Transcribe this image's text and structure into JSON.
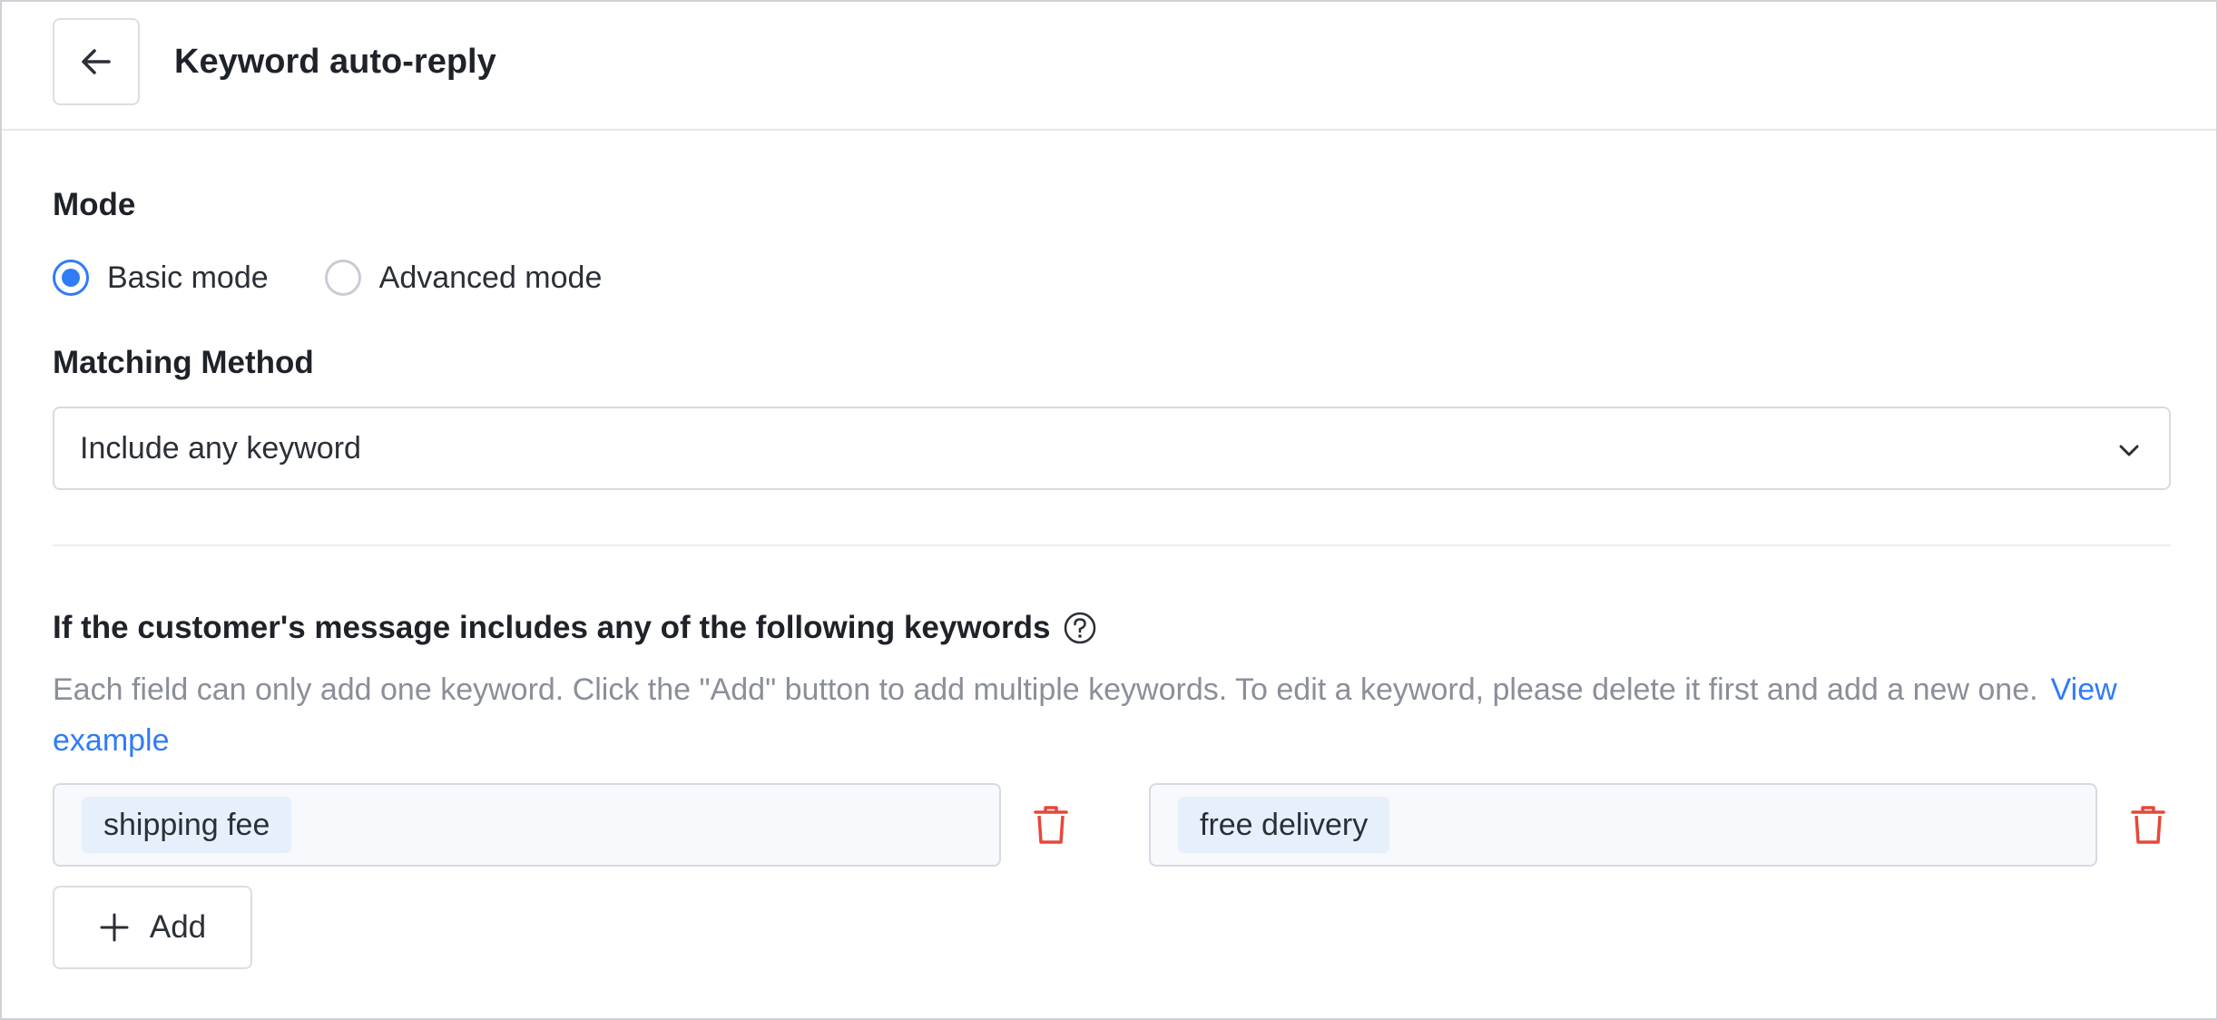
{
  "header": {
    "title": "Keyword auto-reply"
  },
  "mode": {
    "label": "Mode",
    "options": [
      {
        "label": "Basic mode",
        "checked": true
      },
      {
        "label": "Advanced mode",
        "checked": false
      }
    ]
  },
  "matching": {
    "label": "Matching Method",
    "selected": "Include any keyword"
  },
  "keywords": {
    "title": "If the customer's message includes any of the following keywords",
    "description": "Each field can only add one keyword. Click the \"Add\" button to add multiple keywords. To edit a keyword, please delete it first and add a new one.",
    "view_example": "View example",
    "fields": [
      {
        "tag": "shipping fee"
      },
      {
        "tag": "free delivery"
      }
    ],
    "add_label": "Add"
  },
  "colors": {
    "accent": "#2f7cf6",
    "danger": "#e5483a",
    "tag_bg": "#e6f0fd"
  }
}
